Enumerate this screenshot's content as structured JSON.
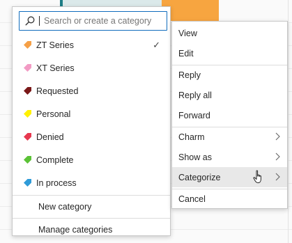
{
  "search": {
    "placeholder": "Search or create a category"
  },
  "categories": [
    {
      "label": "ZT Series",
      "color": "#f5a047",
      "checked": true
    },
    {
      "label": "XT Series",
      "color": "#f29bc4",
      "checked": false
    },
    {
      "label": "Requested",
      "color": "#7a1818",
      "checked": false
    },
    {
      "label": "Personal",
      "color": "#fff100",
      "checked": false
    },
    {
      "label": "Denied",
      "color": "#e7384f",
      "checked": false
    },
    {
      "label": "Complete",
      "color": "#5bc236",
      "checked": false
    },
    {
      "label": "In process",
      "color": "#2f9bd8",
      "checked": false
    }
  ],
  "category_actions": {
    "new": "New category",
    "manage": "Manage categories"
  },
  "check_glyph": "✓",
  "context_menu": {
    "items": [
      {
        "label": "View"
      },
      {
        "label": "Edit"
      },
      {
        "label": "Reply"
      },
      {
        "label": "Reply all"
      },
      {
        "label": "Forward"
      },
      {
        "label": "Charm"
      },
      {
        "label": "Show as"
      },
      {
        "label": "Categorize"
      },
      {
        "label": "Cancel"
      }
    ]
  }
}
